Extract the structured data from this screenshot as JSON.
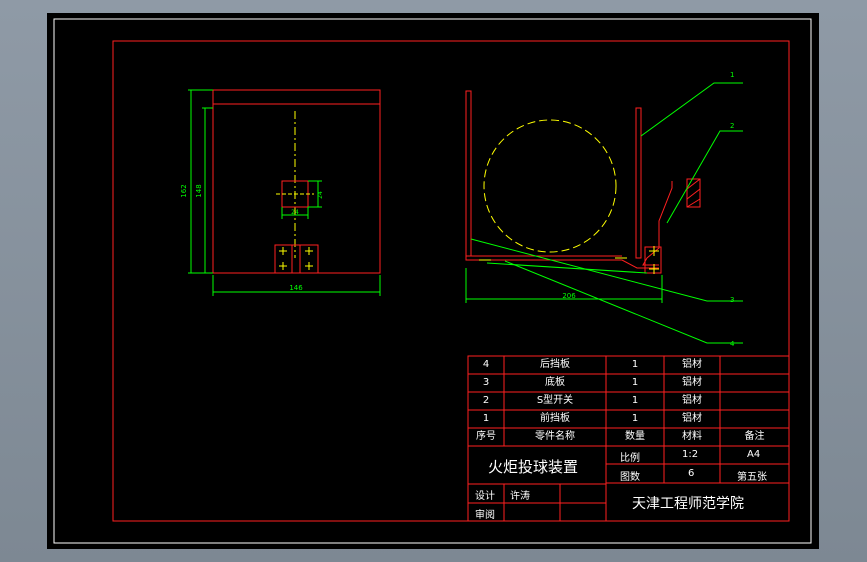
{
  "drawing": {
    "front_view": {
      "dim_height_outer": "162",
      "dim_height_inner": "148",
      "dim_slot_w": "24",
      "dim_slot_h": "24",
      "dim_width": "146"
    },
    "side_view": {
      "dim_width": "206",
      "callouts": [
        "1",
        "2",
        "3",
        "4"
      ]
    }
  },
  "parts_table": {
    "rows": [
      {
        "no": "4",
        "name": "后挡板",
        "qty": "1",
        "material": "铝材",
        "note": ""
      },
      {
        "no": "3",
        "name": "底板",
        "qty": "1",
        "material": "铝材",
        "note": ""
      },
      {
        "no": "2",
        "name": "S型开关",
        "qty": "1",
        "material": "铝材",
        "note": ""
      },
      {
        "no": "1",
        "name": "前挡板",
        "qty": "1",
        "material": "铝材",
        "note": ""
      }
    ],
    "header": {
      "no": "序号",
      "name": "零件名称",
      "qty": "数量",
      "material": "材料",
      "note": "备注"
    }
  },
  "title_block": {
    "title": "火炬投球装置",
    "scale_label": "比例",
    "scale_value": "1:2",
    "paper": "A4",
    "sheets_label": "图数",
    "sheets_value": "6",
    "sheet_no": "第五张",
    "design_label": "设计",
    "designer": "许涛",
    "review_label": "审阅",
    "school": "天津工程师范学院"
  },
  "colors": {
    "frame": "#ff2020",
    "dimension": "#00ff00",
    "center": "#ffff00",
    "text": "#ffffff",
    "accent": "#ffff00"
  }
}
